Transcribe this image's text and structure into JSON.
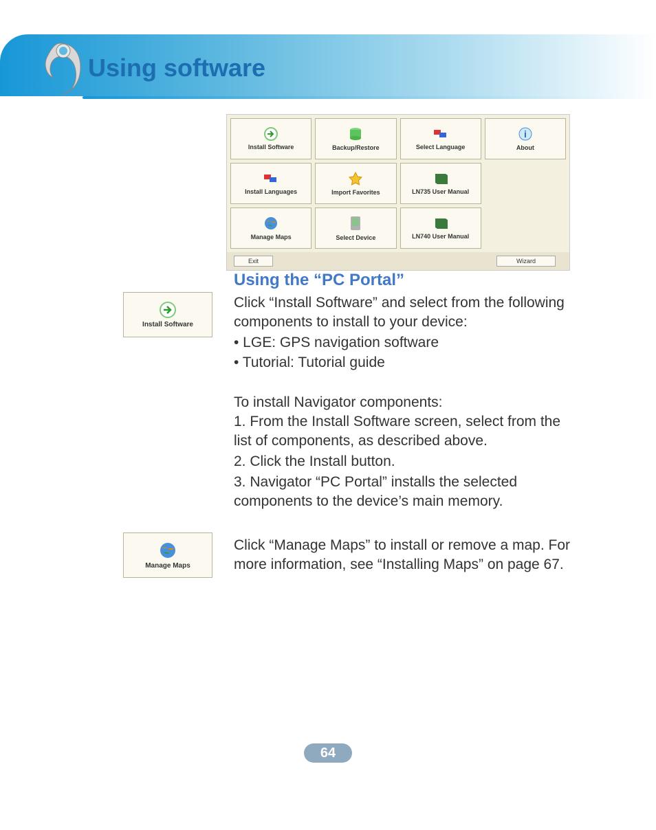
{
  "header": {
    "title": "Using software"
  },
  "portal": {
    "buttons": [
      "Install Software",
      "Backup/Restore",
      "Select Language",
      "About",
      "Install Languages",
      "Import Favorites",
      "LN735 User Manual",
      "",
      "Manage Maps",
      "Select Device",
      "LN740 User Manual",
      ""
    ],
    "footer": {
      "left": "Exit",
      "right": "Wizard"
    }
  },
  "section": {
    "heading": "Using the “PC Portal”",
    "intro": "Click “Install Software” and select from the following components to install to your device:",
    "bullet1": "• LGE: GPS navigation software",
    "bullet2": "• Tutorial: Tutorial guide",
    "subhead": "To install Navigator components:",
    "step1": "1. From the Install Software screen, select from the list of components, as described above.",
    "step2": "2. Click the Install button.",
    "step3": "3. Navigator “PC Portal” installs the selected components to the device’s main memory.",
    "maps": "Click “Manage Maps” to install or remove a map. For more information, see “Installing Maps” on page 67."
  },
  "side": {
    "install": "Install Software",
    "manage": "Manage Maps"
  },
  "page": {
    "number": "64"
  },
  "icons": {
    "arrow_green": "arrow",
    "green_cyl": "backup",
    "flags": "flags",
    "info": "info",
    "star": "star",
    "book": "book",
    "globe": "globe",
    "device": "device"
  }
}
